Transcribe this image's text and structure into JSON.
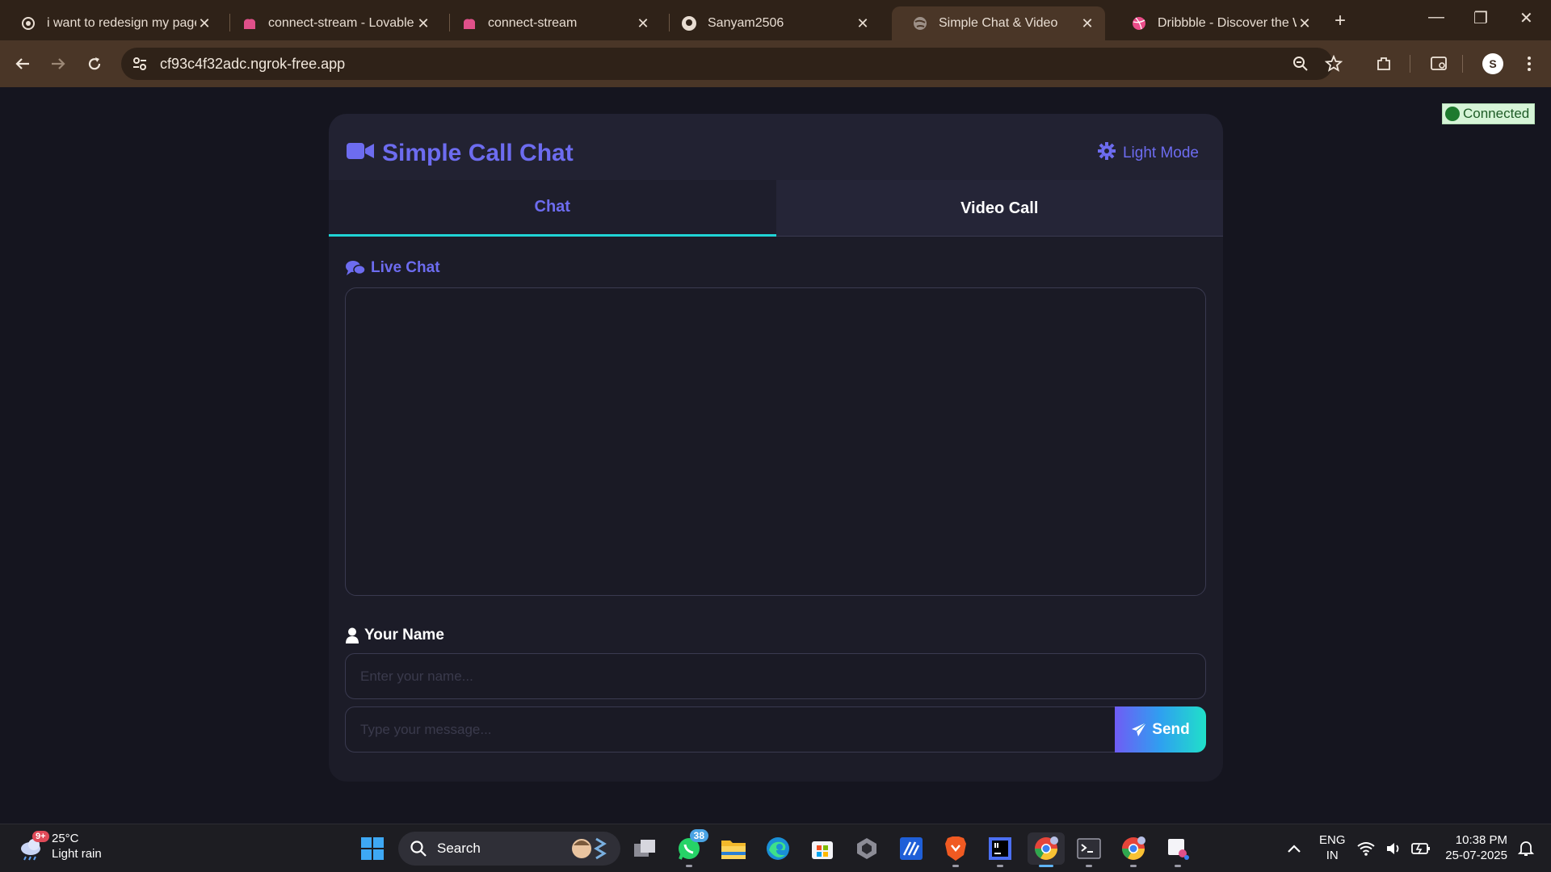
{
  "browser": {
    "tabs": [
      {
        "title": "i want to redesign my page",
        "favicon": "openai-icon",
        "active": false
      },
      {
        "title": "connect-stream - Lovable",
        "favicon": "lovable-icon",
        "active": false
      },
      {
        "title": "connect-stream",
        "favicon": "lovable-icon",
        "active": false
      },
      {
        "title": "Sanyam2506",
        "favicon": "github-icon",
        "active": false
      },
      {
        "title": "Simple Chat & Video",
        "favicon": "globe-icon",
        "active": true
      },
      {
        "title": "Dribbble - Discover the World",
        "favicon": "dribbble-icon",
        "active": false
      }
    ],
    "url": "cf93c4f32adc.ngrok-free.app",
    "profile_initial": "S"
  },
  "page": {
    "connection_status": "Connected",
    "app_title": "Simple Call Chat",
    "theme_toggle_label": "Light Mode",
    "tabs": {
      "chat": "Chat",
      "video": "Video Call"
    },
    "live_chat_label": "Live Chat",
    "name_label": "Your Name",
    "name_placeholder": "Enter your name...",
    "message_placeholder": "Type your message...",
    "send_label": "Send",
    "colors": {
      "accent": "#6d6cf0",
      "tab_underline": "#20d4d6",
      "status_green": "#1e7a2e"
    }
  },
  "taskbar": {
    "weather_temp": "25°C",
    "weather_desc": "Light rain",
    "weather_badge": "9+",
    "search_label": "Search",
    "whatsapp_badge": "38",
    "lang_top": "ENG",
    "lang_bottom": "IN",
    "time": "10:38 PM",
    "date": "25-07-2025"
  }
}
